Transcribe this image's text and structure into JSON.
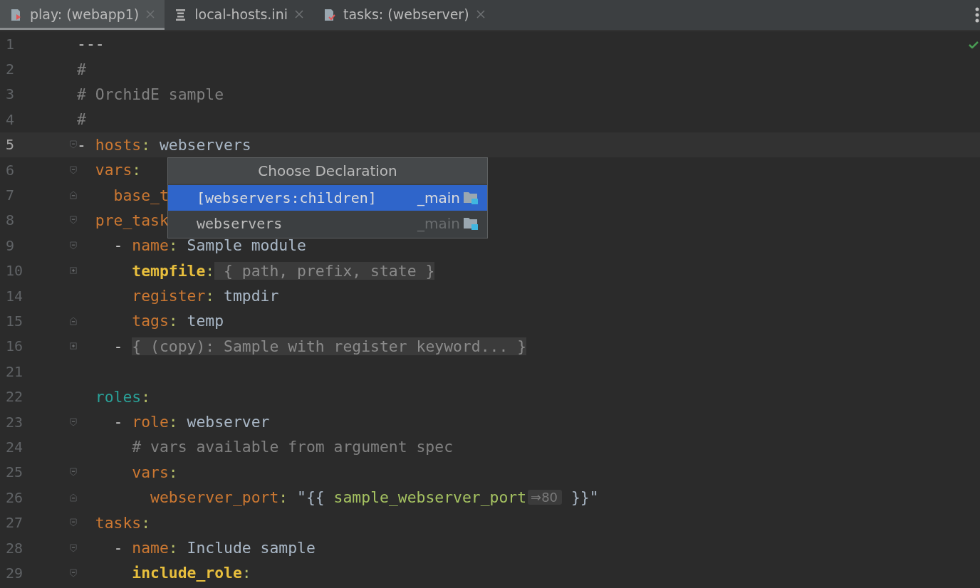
{
  "tabs": [
    {
      "label": "play: (webapp1)",
      "kind": "playbook",
      "selected": true
    },
    {
      "label": "local-hosts.ini",
      "kind": "inventory",
      "selected": false
    },
    {
      "label": "tasks: (webserver)",
      "kind": "tasks",
      "selected": false
    }
  ],
  "editor": {
    "lines": [
      {
        "number": "1",
        "current": false,
        "kind": "plain",
        "tokens": [
          {
            "kind": "marker",
            "text": "---"
          }
        ]
      },
      {
        "number": "2",
        "current": false,
        "kind": "plain",
        "tokens": [
          {
            "kind": "comment",
            "text": "#"
          }
        ]
      },
      {
        "number": "3",
        "current": false,
        "kind": "plain",
        "tokens": [
          {
            "kind": "comment",
            "text": "# OrchidE sample"
          }
        ]
      },
      {
        "number": "4",
        "current": false,
        "kind": "plain",
        "tokens": [
          {
            "kind": "comment",
            "text": "#"
          }
        ]
      },
      {
        "number": "5",
        "current": true,
        "kind": "fold-start",
        "tokens": [
          {
            "kind": "plain",
            "text": "-"
          },
          {
            "kind": "key",
            "text": " hosts"
          },
          {
            "kind": "colon",
            "text": ":"
          },
          {
            "kind": "value",
            "text": " webservers"
          }
        ]
      },
      {
        "number": "6",
        "current": false,
        "kind": "fold-start",
        "tokens": [
          {
            "kind": "key",
            "text": "  vars"
          },
          {
            "kind": "colon",
            "text": ":"
          }
        ]
      },
      {
        "number": "7",
        "current": false,
        "kind": "fold-end",
        "tokens": [
          {
            "kind": "key",
            "text": "    base_t"
          }
        ]
      },
      {
        "number": "8",
        "current": false,
        "kind": "fold-start",
        "tokens": [
          {
            "kind": "key",
            "text": "  pre_task"
          }
        ]
      },
      {
        "number": "9",
        "current": false,
        "kind": "fold-start",
        "tokens": [
          {
            "kind": "plain",
            "text": "    -"
          },
          {
            "kind": "key",
            "text": " name"
          },
          {
            "kind": "colon",
            "text": ":"
          },
          {
            "kind": "value",
            "text": " Sample module"
          }
        ]
      },
      {
        "number": "10",
        "current": false,
        "kind": "fold-expand",
        "tokens": [
          {
            "kind": "module",
            "text": "      tempfile"
          },
          {
            "kind": "colon",
            "text": ":"
          },
          {
            "kind": "folded",
            "text": " { path, prefix, state }"
          }
        ]
      },
      {
        "number": "14",
        "current": false,
        "kind": "plain",
        "tokens": [
          {
            "kind": "key",
            "text": "      register"
          },
          {
            "kind": "colon",
            "text": ":"
          },
          {
            "kind": "value",
            "text": " tmpdir"
          }
        ]
      },
      {
        "number": "15",
        "current": false,
        "kind": "fold-end",
        "tokens": [
          {
            "kind": "key",
            "text": "      tags"
          },
          {
            "kind": "colon",
            "text": ":"
          },
          {
            "kind": "value",
            "text": " temp"
          }
        ]
      },
      {
        "number": "16",
        "current": false,
        "kind": "fold-expand",
        "tokens": [
          {
            "kind": "plain",
            "text": "    - "
          },
          {
            "kind": "folded",
            "text": "{ (copy): Sample with register keyword... }"
          }
        ]
      },
      {
        "number": "21",
        "current": false,
        "kind": "plain"
      },
      {
        "number": "22",
        "current": false,
        "kind": "plain",
        "tokens": [
          {
            "kind": "section",
            "text": "  roles"
          },
          {
            "kind": "colon",
            "text": ":"
          }
        ]
      },
      {
        "number": "23",
        "current": false,
        "kind": "fold-start",
        "tokens": [
          {
            "kind": "plain",
            "text": "    -"
          },
          {
            "kind": "key",
            "text": " role"
          },
          {
            "kind": "colon",
            "text": ":"
          },
          {
            "kind": "value",
            "text": " webserver"
          }
        ]
      },
      {
        "number": "24",
        "current": false,
        "kind": "plain",
        "tokens": [
          {
            "kind": "comment",
            "text": "      # vars available from argument spec"
          }
        ]
      },
      {
        "number": "25",
        "current": false,
        "kind": "fold-start",
        "tokens": [
          {
            "kind": "key",
            "text": "      vars"
          },
          {
            "kind": "colon",
            "text": ":"
          }
        ]
      },
      {
        "number": "26",
        "current": false,
        "kind": "fold-end",
        "tokens": [
          {
            "kind": "key",
            "text": "        webserver_port"
          },
          {
            "kind": "colon",
            "text": ":"
          },
          {
            "kind": "value",
            "text": " \"{{"
          },
          {
            "kind": "variable",
            "text": " sample_webserver_port"
          },
          {
            "kind": "hint",
            "text": "⇒80"
          },
          {
            "kind": "value",
            "text": " }}\""
          }
        ]
      },
      {
        "number": "27",
        "current": false,
        "kind": "fold-start",
        "tokens": [
          {
            "kind": "key",
            "text": "  tasks"
          },
          {
            "kind": "colon",
            "text": ":"
          }
        ]
      },
      {
        "number": "28",
        "current": false,
        "kind": "fold-start",
        "tokens": [
          {
            "kind": "plain",
            "text": "    -"
          },
          {
            "kind": "key",
            "text": " name"
          },
          {
            "kind": "colon",
            "text": ":"
          },
          {
            "kind": "value",
            "text": " Include sample"
          }
        ]
      },
      {
        "number": "29",
        "current": false,
        "kind": "fold-start",
        "tokens": [
          {
            "kind": "module",
            "text": "      include_role"
          },
          {
            "kind": "colon",
            "text": ":"
          }
        ]
      }
    ]
  },
  "popup": {
    "title": "Choose Declaration",
    "items": [
      {
        "label": "[webservers:children]",
        "location": "_main",
        "selected": true
      },
      {
        "label": "webservers",
        "location": "_main",
        "selected": false
      }
    ]
  }
}
